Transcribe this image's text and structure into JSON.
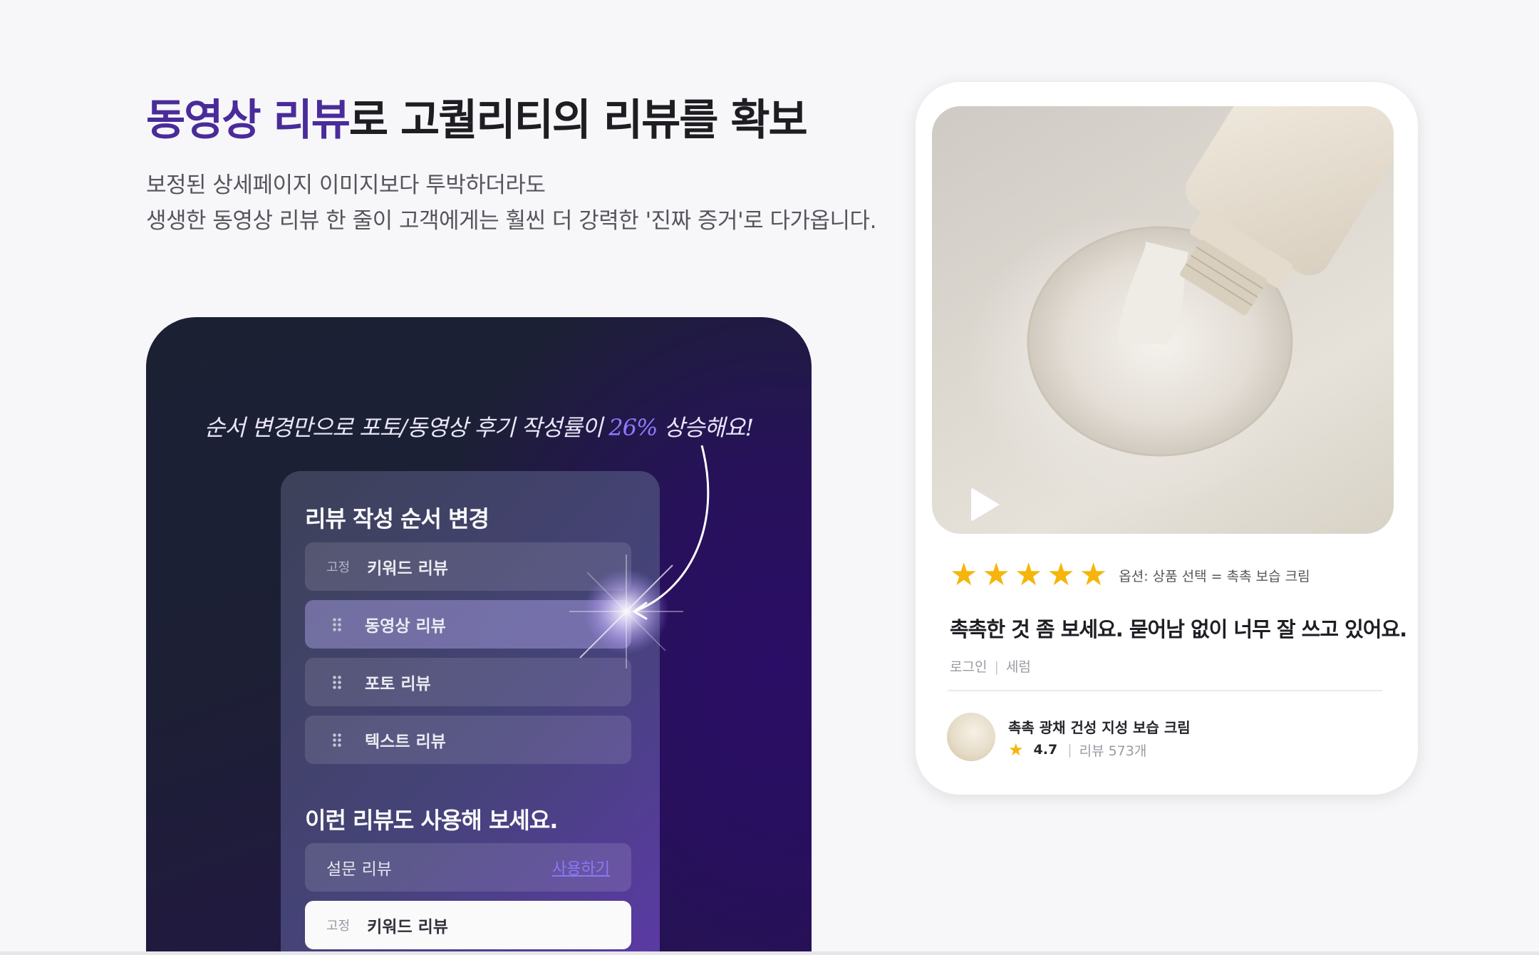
{
  "headline": {
    "accent": "동영상 리뷰",
    "rest": "로 고퀄리티의 리뷰를 확보"
  },
  "subtext": {
    "line1": "보정된 상세페이지 이미지보다 투박하더라도",
    "line2": "생생한 동영상 리뷰 한 줄이 고객에게는 훨씬 더 강력한 '진짜 증거'로 다가옵니다."
  },
  "callout": {
    "before": "순서 변경만으로 포토/동영상 후기 작성률이 ",
    "percent": "26%",
    "after": " 상승해요!"
  },
  "order_card": {
    "title": "리뷰 작성 순서 변경",
    "fixed_tag": "고정",
    "items": [
      "키워드 리뷰",
      "동영상 리뷰",
      "포토 리뷰",
      "텍스트 리뷰"
    ]
  },
  "suggest": {
    "title": "이런 리뷰도 사용해 보세요.",
    "survey_label": "설문 리뷰",
    "use_label": "사용하기",
    "fixed_tag": "고정",
    "keyword_label": "키워드 리뷰"
  },
  "review": {
    "star_count": 5,
    "option": "옵션: 상품 선택 = 촉촉 보습 크림",
    "text": "촉촉한 것 좀 보세요. 묻어남 없이 너무 잘 쓰고 있어요.",
    "user": "로그인",
    "category": "세럼"
  },
  "product": {
    "name": "촉촉 광채 건성 지성 보습 크림",
    "rating": "4.7",
    "review_count": "리뷰 573개"
  },
  "colors": {
    "accent": "#4a2b9a",
    "star": "#f5b50a",
    "link": "#8c7bff"
  }
}
